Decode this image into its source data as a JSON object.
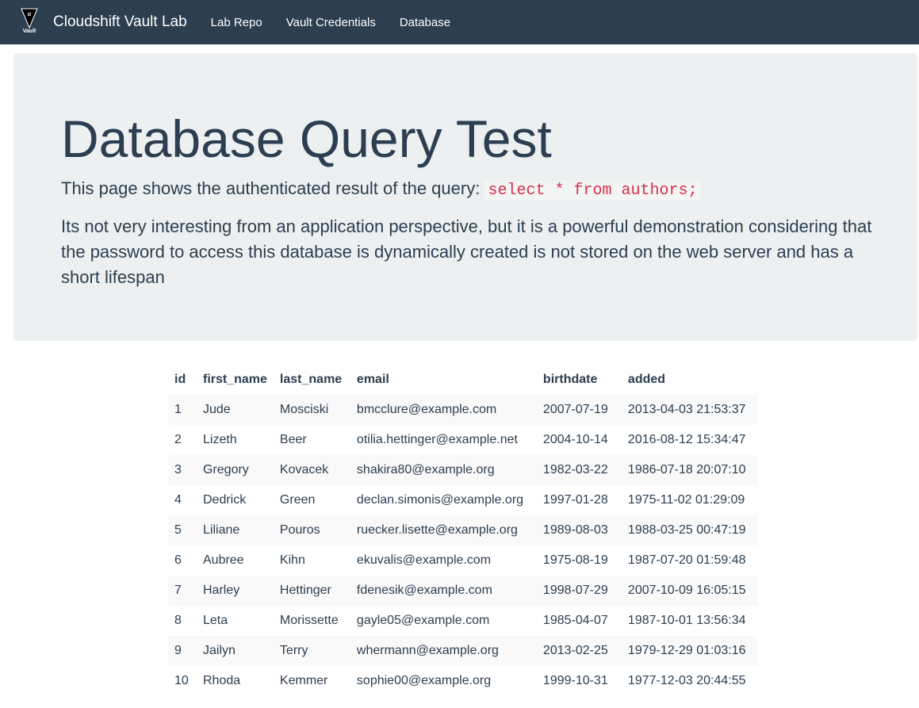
{
  "navbar": {
    "logo_text": "Vault",
    "brand": "Cloudshift Vault Lab",
    "links": [
      "Lab Repo",
      "Vault Credentials",
      "Database"
    ]
  },
  "jumbotron": {
    "title": "Database Query Test",
    "lead_prefix": "This page shows the authenticated result of the query:",
    "query": "select * from authors;",
    "description": "Its not very interesting from an application perspective, but it is a powerful demonstration considering that the password to access this database is dynamically created is not stored on the web server and has a short lifespan"
  },
  "table": {
    "headers": [
      "id",
      "first_name",
      "last_name",
      "email",
      "birthdate",
      "added"
    ],
    "rows": [
      [
        "1",
        "Jude",
        "Mosciski",
        "bmcclure@example.com",
        "2007-07-19",
        "2013-04-03 21:53:37"
      ],
      [
        "2",
        "Lizeth",
        "Beer",
        "otilia.hettinger@example.net",
        "2004-10-14",
        "2016-08-12 15:34:47"
      ],
      [
        "3",
        "Gregory",
        "Kovacek",
        "shakira80@example.org",
        "1982-03-22",
        "1986-07-18 20:07:10"
      ],
      [
        "4",
        "Dedrick",
        "Green",
        "declan.simonis@example.org",
        "1997-01-28",
        "1975-11-02 01:29:09"
      ],
      [
        "5",
        "Liliane",
        "Pouros",
        "ruecker.lisette@example.org",
        "1989-08-03",
        "1988-03-25 00:47:19"
      ],
      [
        "6",
        "Aubree",
        "Kihn",
        "ekuvalis@example.com",
        "1975-08-19",
        "1987-07-20 01:59:48"
      ],
      [
        "7",
        "Harley",
        "Hettinger",
        "fdenesik@example.com",
        "1998-07-29",
        "2007-10-09 16:05:15"
      ],
      [
        "8",
        "Leta",
        "Morissette",
        "gayle05@example.com",
        "1985-04-07",
        "1987-10-01 13:56:34"
      ],
      [
        "9",
        "Jailyn",
        "Terry",
        "whermann@example.org",
        "2013-02-25",
        "1979-12-29 01:03:16"
      ],
      [
        "10",
        "Rhoda",
        "Kemmer",
        "sophie00@example.org",
        "1999-10-31",
        "1977-12-03 20:44:55"
      ]
    ]
  }
}
